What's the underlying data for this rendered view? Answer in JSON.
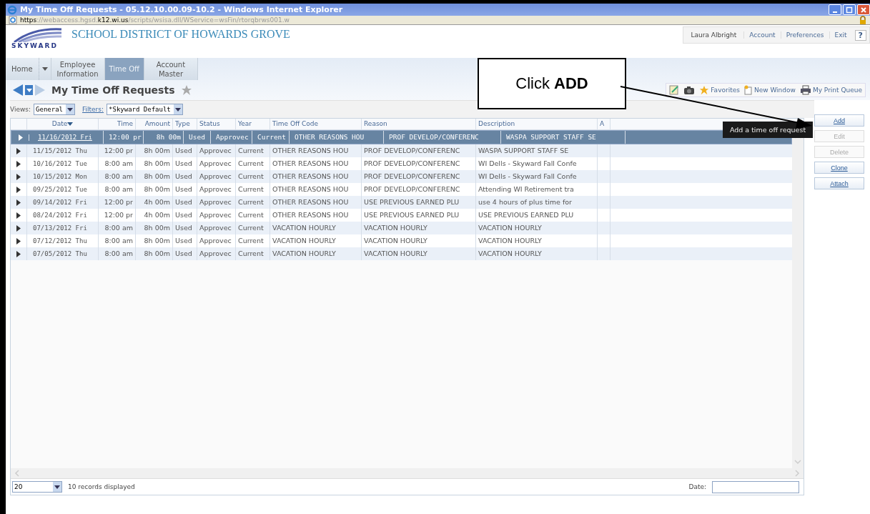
{
  "window": {
    "title": "My Time Off Requests - 05.12.10.00.09-10.2 - Windows Internet Explorer"
  },
  "address_bar": {
    "scheme": "https",
    "pre": "://webaccess.hgsd.",
    "domain": "k12.wi.us",
    "post": "/scripts/wsisa.dll/WService=wsFin/rtorqbrws001.w"
  },
  "header": {
    "district": "SCHOOL DISTRICT OF HOWARDS GROVE",
    "logo_text": "SKYWARD",
    "user": "Laura Albright",
    "links": [
      "Account",
      "Preferences",
      "Exit"
    ],
    "help": "?"
  },
  "nav_tabs": [
    {
      "label": "Home",
      "selected": false,
      "dropdown": true
    },
    {
      "label": "Employee Information",
      "selected": false,
      "dropdown": false
    },
    {
      "label": "Time Off",
      "selected": true,
      "dropdown": false
    },
    {
      "label": "Account Master",
      "selected": false,
      "dropdown": false
    }
  ],
  "page_title": "My Time Off Requests",
  "toolbar": {
    "favorites": "Favorites",
    "new_window": "New Window",
    "print_queue": "My Print Queue"
  },
  "filters": {
    "views_label": "Views:",
    "views_value": "General",
    "filters_label": "Filters:",
    "filters_value": "*Skyward Default"
  },
  "table": {
    "columns": [
      "Date",
      "Time",
      "Amount",
      "Type",
      "Status",
      "Year",
      "Time Off Code",
      "Reason",
      "Description",
      "A"
    ],
    "rows": [
      {
        "selected": true,
        "cells": [
          "11/16/2012 Fri",
          "12:00 pr",
          "8h 00m",
          "Used",
          "Approvec",
          "Current",
          "OTHER REASONS HOU",
          "PROF DEVELOP/CONFERENC",
          "WASPA SUPPORT STAFF SE",
          ""
        ]
      },
      {
        "selected": false,
        "cells": [
          "11/15/2012 Thu",
          "12:00 pr",
          "8h 00m",
          "Used",
          "Approvec",
          "Current",
          "OTHER REASONS HOU",
          "PROF DEVELOP/CONFERENC",
          "WASPA SUPPORT STAFF SE",
          ""
        ]
      },
      {
        "selected": false,
        "cells": [
          "10/16/2012 Tue",
          "8:00 am",
          "8h 00m",
          "Used",
          "Approvec",
          "Current",
          "OTHER REASONS HOU",
          "PROF DEVELOP/CONFERENC",
          "WI Dells - Skyward Fall Confe",
          ""
        ]
      },
      {
        "selected": false,
        "cells": [
          "10/15/2012 Mon",
          "8:00 am",
          "8h 00m",
          "Used",
          "Approvec",
          "Current",
          "OTHER REASONS HOU",
          "PROF DEVELOP/CONFERENC",
          "WI Dells - Skyward Fall Confe",
          ""
        ]
      },
      {
        "selected": false,
        "cells": [
          "09/25/2012 Tue",
          "8:00 am",
          "8h 00m",
          "Used",
          "Approvec",
          "Current",
          "OTHER REASONS HOU",
          "PROF DEVELOP/CONFERENC",
          "Attending WI Retirement tra",
          ""
        ]
      },
      {
        "selected": false,
        "cells": [
          "09/14/2012 Fri",
          "12:00 pr",
          "4h 00m",
          "Used",
          "Approvec",
          "Current",
          "OTHER REASONS HOU",
          "USE PREVIOUS EARNED PLU",
          "use 4 hours of plus time for",
          ""
        ]
      },
      {
        "selected": false,
        "cells": [
          "08/24/2012 Fri",
          "12:00 pr",
          "4h 00m",
          "Used",
          "Approvec",
          "Current",
          "OTHER REASONS HOU",
          "USE PREVIOUS EARNED PLU",
          "USE PREVIOUS EARNED PLU",
          ""
        ]
      },
      {
        "selected": false,
        "cells": [
          "07/13/2012 Fri",
          "8:00 am",
          "8h 00m",
          "Used",
          "Approvec",
          "Current",
          "VACATION HOURLY",
          "VACATION HOURLY",
          "VACATION HOURLY",
          ""
        ]
      },
      {
        "selected": false,
        "cells": [
          "07/12/2012 Thu",
          "8:00 am",
          "8h 00m",
          "Used",
          "Approvec",
          "Current",
          "VACATION HOURLY",
          "VACATION HOURLY",
          "VACATION HOURLY",
          ""
        ]
      },
      {
        "selected": false,
        "cells": [
          "07/05/2012 Thu",
          "8:00 am",
          "8h 00m",
          "Used",
          "Approvec",
          "Current",
          "VACATION HOURLY",
          "VACATION HOURLY",
          "VACATION HOURLY",
          ""
        ]
      }
    ]
  },
  "actions": [
    {
      "label": "Add",
      "disabled": false
    },
    {
      "label": "Edit",
      "disabled": true
    },
    {
      "label": "Delete",
      "disabled": true
    },
    {
      "label": "Clone",
      "disabled": false
    },
    {
      "label": "Attach",
      "disabled": false
    }
  ],
  "footer": {
    "page_size": "20",
    "records": "10 records displayed",
    "date_label": "Date:"
  },
  "tooltip": "Add a time off request",
  "callout": "Click **ADD**"
}
